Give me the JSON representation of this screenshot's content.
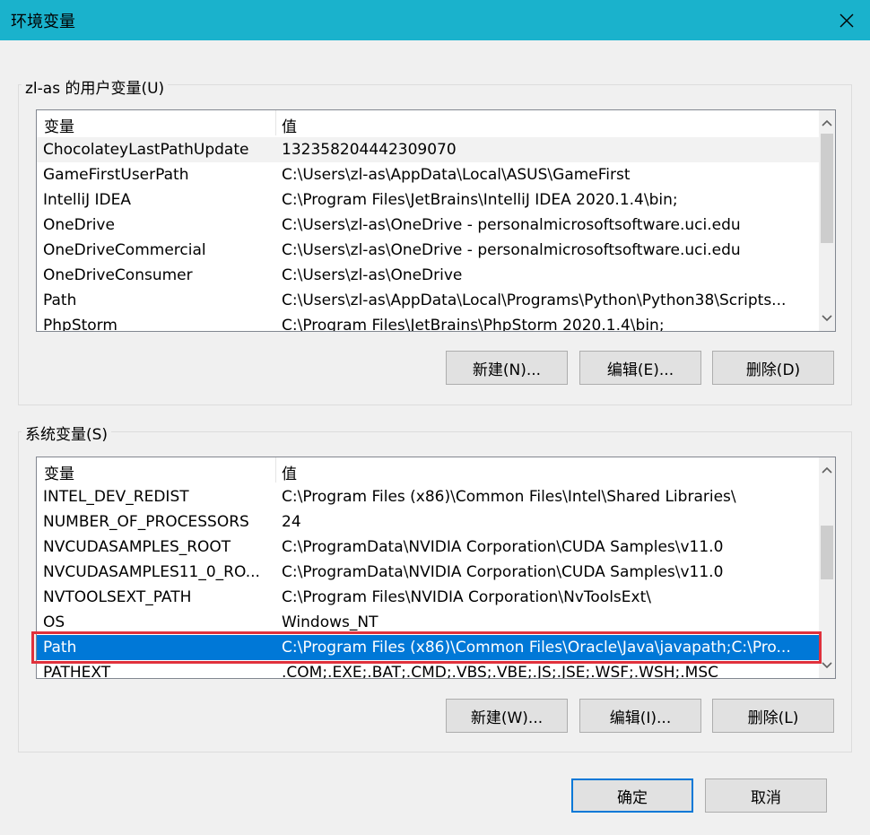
{
  "window": {
    "title": "环境变量"
  },
  "user_vars": {
    "label": "zl-as 的用户变量(U)",
    "columns": [
      "变量",
      "值"
    ],
    "rows": [
      {
        "name": "ChocolateyLastPathUpdate",
        "value": "132358204442309070"
      },
      {
        "name": "GameFirstUserPath",
        "value": "C:\\Users\\zl-as\\AppData\\Local\\ASUS\\GameFirst"
      },
      {
        "name": "IntelliJ IDEA",
        "value": "C:\\Program Files\\JetBrains\\IntelliJ IDEA 2020.1.4\\bin;"
      },
      {
        "name": "OneDrive",
        "value": "C:\\Users\\zl-as\\OneDrive - personalmicrosoftsoftware.uci.edu"
      },
      {
        "name": "OneDriveCommercial",
        "value": "C:\\Users\\zl-as\\OneDrive - personalmicrosoftsoftware.uci.edu"
      },
      {
        "name": "OneDriveConsumer",
        "value": "C:\\Users\\zl-as\\OneDrive"
      },
      {
        "name": "Path",
        "value": "C:\\Users\\zl-as\\AppData\\Local\\Programs\\Python\\Python38\\Scripts..."
      },
      {
        "name": "PhpStorm",
        "value": "C:\\Program Files\\JetBrains\\PhpStorm 2020.1.4\\bin;"
      }
    ],
    "buttons": {
      "new": "新建(N)...",
      "edit": "编辑(E)...",
      "delete": "删除(D)"
    }
  },
  "system_vars": {
    "label": "系统变量(S)",
    "columns": [
      "变量",
      "值"
    ],
    "rows": [
      {
        "name": "INTEL_DEV_REDIST",
        "value": "C:\\Program Files (x86)\\Common Files\\Intel\\Shared Libraries\\"
      },
      {
        "name": "NUMBER_OF_PROCESSORS",
        "value": "24"
      },
      {
        "name": "NVCUDASAMPLES_ROOT",
        "value": "C:\\ProgramData\\NVIDIA Corporation\\CUDA Samples\\v11.0"
      },
      {
        "name": "NVCUDASAMPLES11_0_RO...",
        "value": "C:\\ProgramData\\NVIDIA Corporation\\CUDA Samples\\v11.0"
      },
      {
        "name": "NVTOOLSEXT_PATH",
        "value": "C:\\Program Files\\NVIDIA Corporation\\NvToolsExt\\"
      },
      {
        "name": "OS",
        "value": "Windows_NT"
      },
      {
        "name": "Path",
        "value": "C:\\Program Files (x86)\\Common Files\\Oracle\\Java\\javapath;C:\\Pro..."
      },
      {
        "name": "PATHEXT",
        "value": ".COM;.EXE;.BAT;.CMD;.VBS;.VBE;.JS;.JSE;.WSF;.WSH;.MSC"
      }
    ],
    "buttons": {
      "new": "新建(W)...",
      "edit": "编辑(I)...",
      "delete": "删除(L)"
    }
  },
  "dialog_buttons": {
    "ok": "确定",
    "cancel": "取消"
  },
  "colors": {
    "titlebar": "#1ab2cc",
    "selection": "#0078d7",
    "highlight_outline": "#e0313c"
  }
}
